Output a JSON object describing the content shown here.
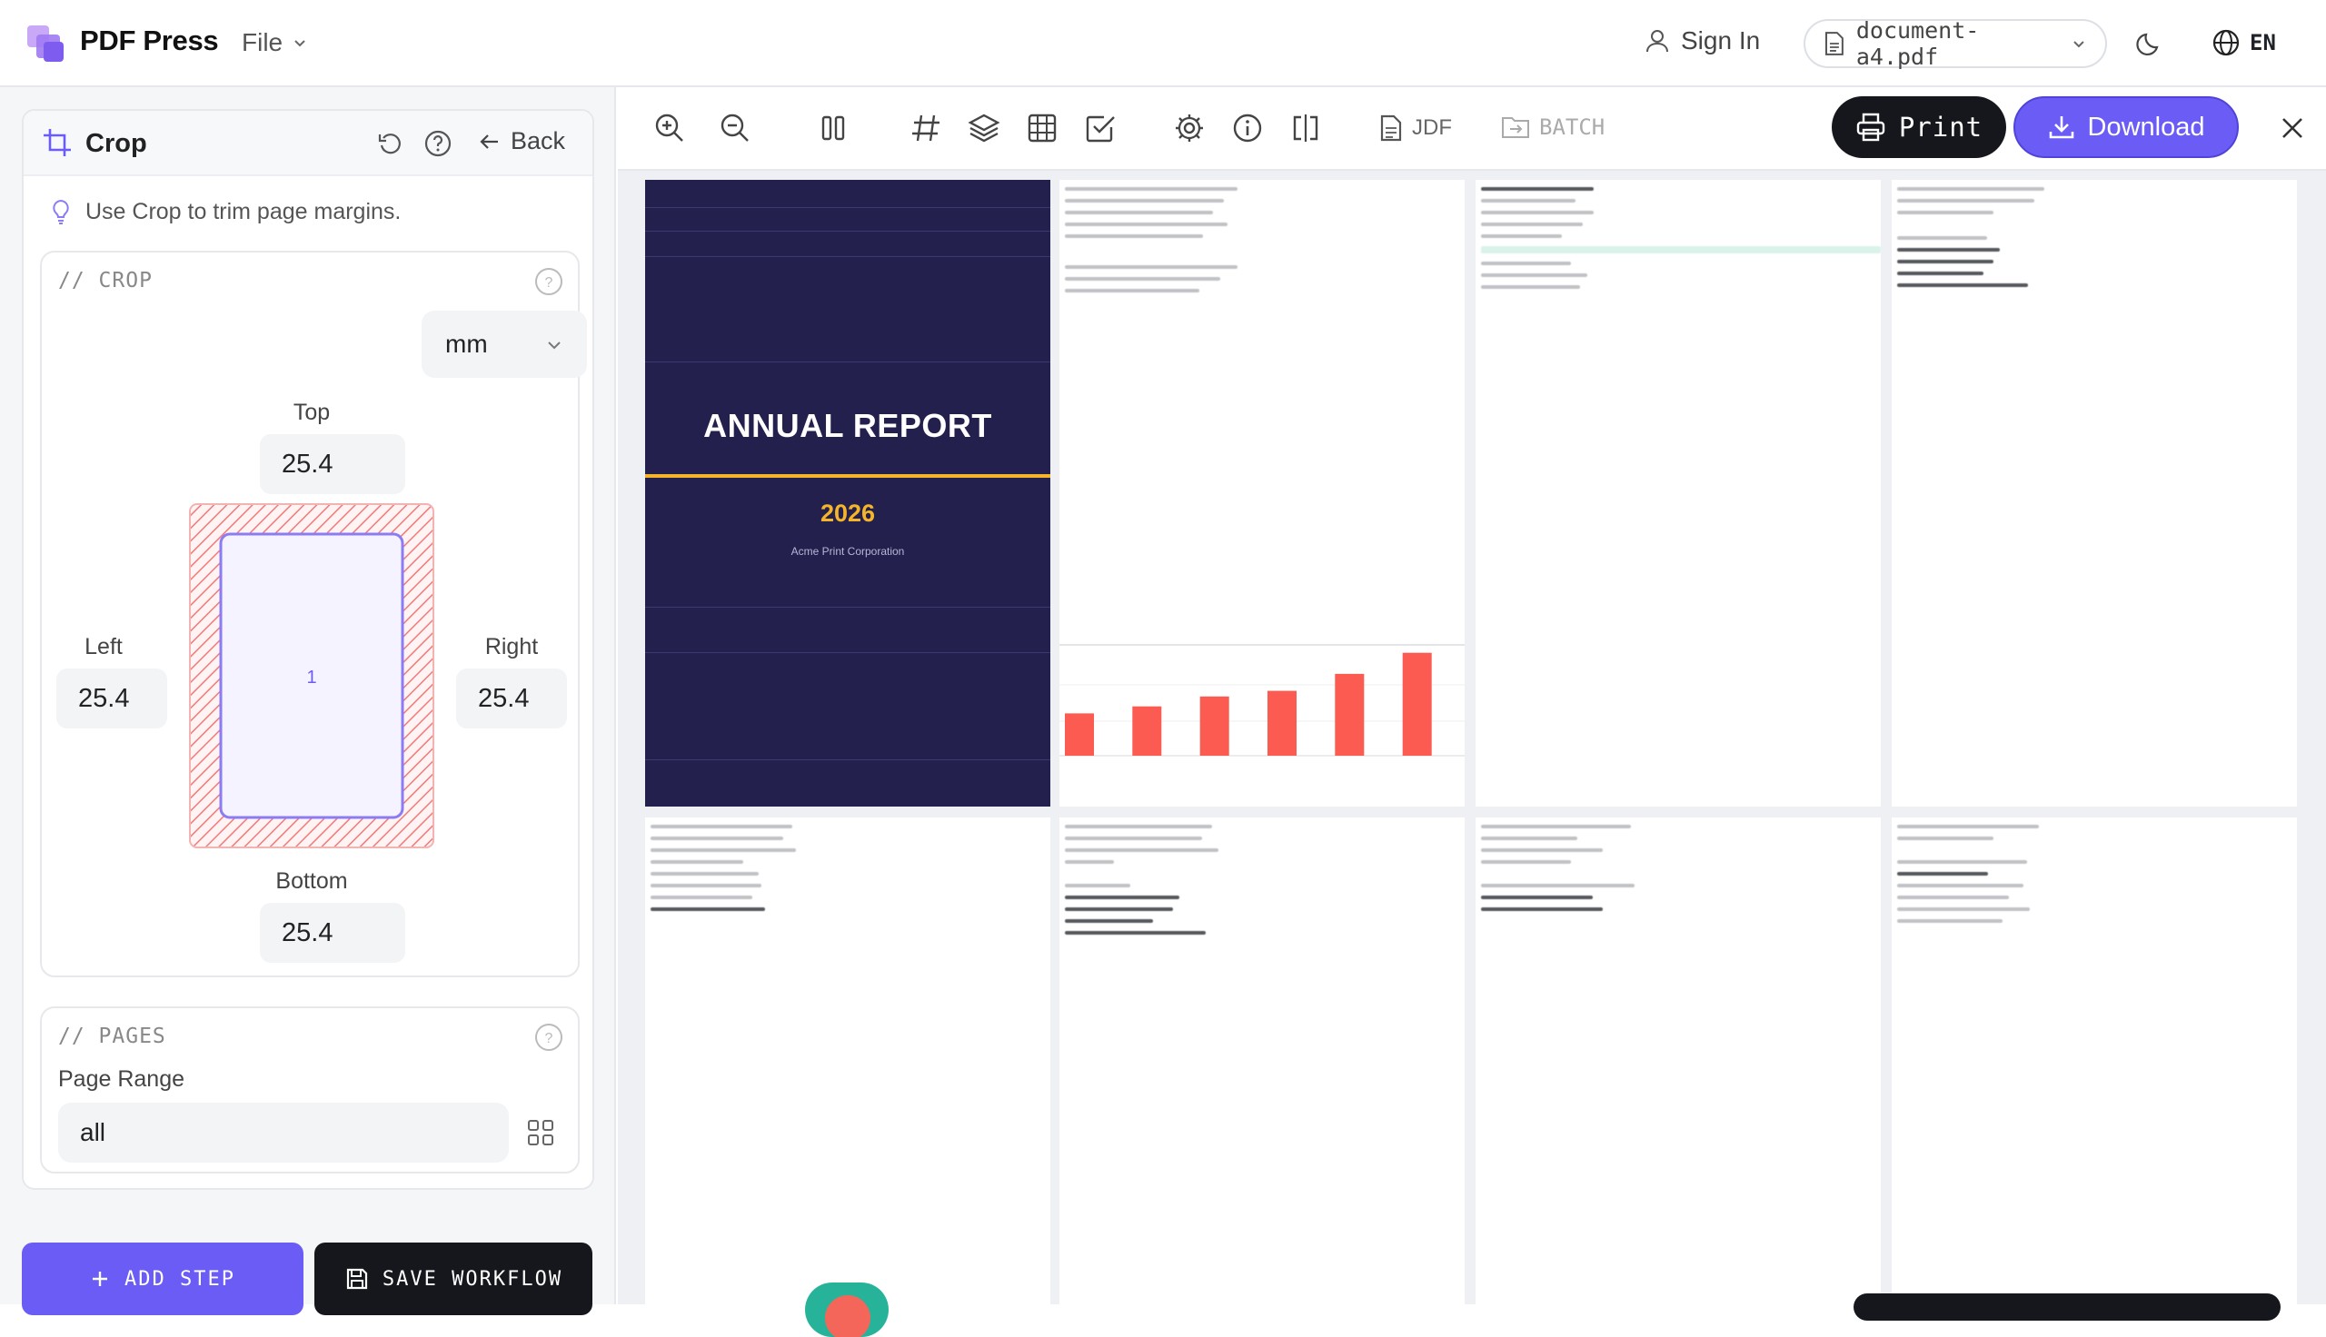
{
  "header": {
    "app_name": "PDF Press",
    "file_menu": "File",
    "sign_in": "Sign In",
    "document": "document-a4.pdf",
    "language": "EN"
  },
  "panel": {
    "title": "Crop",
    "back": "Back",
    "tip": "Use Crop to trim page margins.",
    "crop_section": {
      "label": "// CROP",
      "unit": "mm",
      "top_label": "Top",
      "top_value": "25.4",
      "left_label": "Left",
      "left_value": "25.4",
      "right_label": "Right",
      "right_value": "25.4",
      "bottom_label": "Bottom",
      "bottom_value": "25.4",
      "preview_page": "1"
    },
    "pages_section": {
      "label": "// PAGES",
      "range_label": "Page Range",
      "range_value": "all"
    },
    "add_step": "ADD STEP",
    "save_workflow": "SAVE WORKFLOW"
  },
  "toolbar": {
    "jdf": "JDF",
    "batch": "BATCH",
    "print": "Print",
    "download": "Download"
  },
  "preview": {
    "cover_title": "ANNUAL REPORT",
    "cover_year": "2026",
    "cover_company": "Acme Print Corporation",
    "chart_values": [
      30,
      35,
      42,
      46,
      58,
      73
    ]
  },
  "colors": {
    "accent": "#6b5cf6",
    "dark": "#15171c",
    "cover_bg": "#23204d",
    "cover_gold": "#f5b52a",
    "bar": "#fb5b50"
  }
}
